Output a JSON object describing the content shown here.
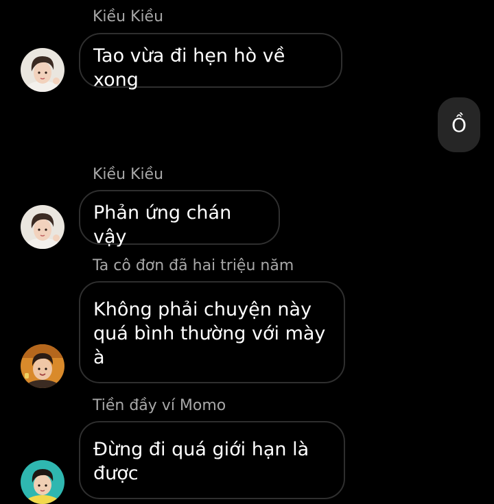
{
  "messages": [
    {
      "sender": "Kiều Kiều",
      "text": "Tao vừa đi hẹn hò về xong"
    },
    {
      "sender": "",
      "text": "Ồ"
    },
    {
      "sender": "Kiều Kiều",
      "text": "Phản ứng chán vậy"
    },
    {
      "sender": "Ta cô đơn đã hai triệu năm",
      "text": "Không phải chuyện này quá bình thường với mày à"
    },
    {
      "sender": "Tiền đầy ví Momo",
      "text": "Đừng đi quá giới hạn là được"
    }
  ],
  "colors": {
    "background": "#000000",
    "incoming_border": "#2f2f2f",
    "outgoing_bubble": "#262626",
    "sender_name": "#a8a8a8",
    "text": "#ffffff"
  },
  "icons": [
    "avatar-kieu-kieu",
    "avatar-ta-co-don",
    "avatar-tien-day-vi"
  ]
}
